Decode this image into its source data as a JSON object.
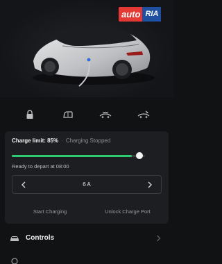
{
  "watermark": {
    "part1": "auto",
    "part2": "RIA"
  },
  "quick_actions": [
    {
      "icon": "lock-icon"
    },
    {
      "icon": "frunk-icon"
    },
    {
      "icon": "trunk-icon"
    },
    {
      "icon": "charge-port-icon"
    }
  ],
  "charging": {
    "limit_label": "Charge limit: 85%",
    "separator": "·",
    "status": "Charging Stopped",
    "charge_limit_percent": 85,
    "depart_text": "Ready to depart at 08:00",
    "amperage": "6 A",
    "start_button": "Start Charging",
    "unlock_button": "Unlock Charge Port"
  },
  "controls": {
    "label": "Controls"
  },
  "colors": {
    "background": "#111214",
    "card": "#1d1e21",
    "accent_green": "#2ecc71",
    "watermark_red": "#e53935",
    "watermark_blue": "#1f4fa0"
  }
}
